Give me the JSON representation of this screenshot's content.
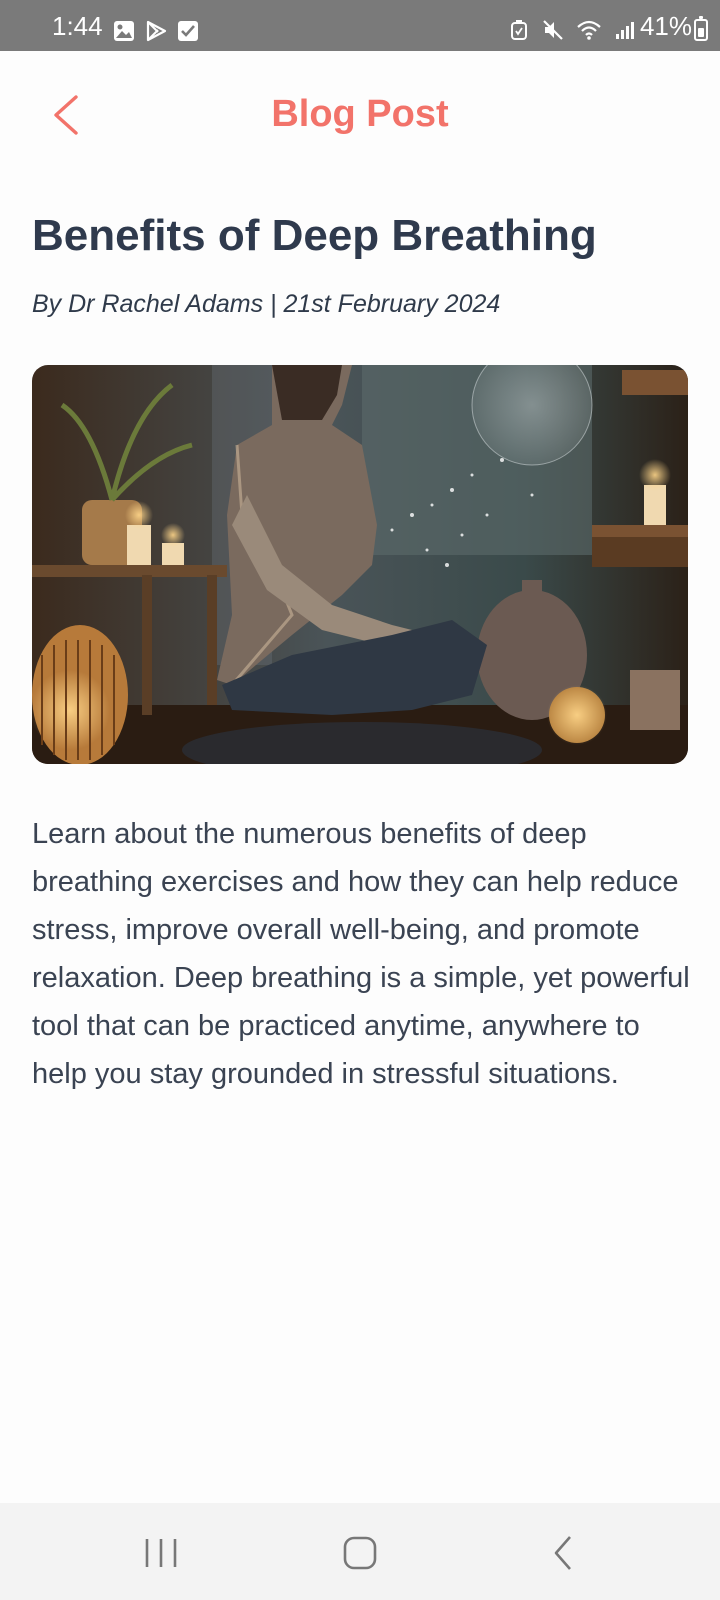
{
  "status_bar": {
    "time": "1:44",
    "battery": "41%",
    "left_icons": [
      "gallery-icon",
      "play-store-icon",
      "checkbox-icon"
    ],
    "right_icons": [
      "alarm-icon",
      "mute-icon",
      "wifi-icon",
      "signal-icon"
    ]
  },
  "header": {
    "title": "Blog Post",
    "back_icon": "chevron-left-icon"
  },
  "post": {
    "title": "Benefits of Deep Breathing",
    "byline": "By Dr Rachel Adams | 21st February 2024",
    "body": "Learn about the numerous benefits of deep breathing exercises and how they can help reduce stress, improve overall well-being, and promote relaxation. Deep breathing is a simple, yet powerful tool that can be practiced anytime, anywhere to help you stay grounded in stressful situations."
  },
  "colors": {
    "accent": "#f2736a",
    "title_text": "#2f3a4d",
    "status_bar_bg": "#7a7a7a",
    "nav_bar_bg": "#f3f3f3"
  },
  "nav_bar": {
    "icons": [
      "recent-apps-icon",
      "home-icon",
      "back-icon"
    ]
  }
}
